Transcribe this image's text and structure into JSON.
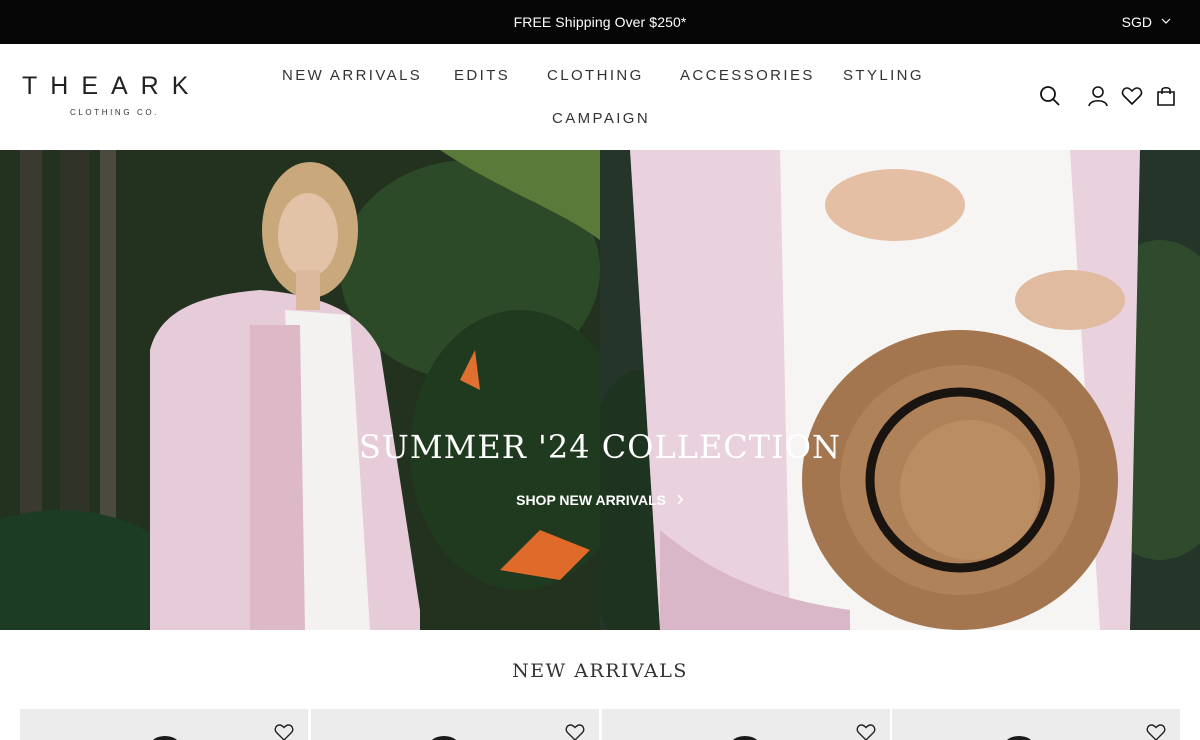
{
  "announcement": {
    "text": "FREE Shipping Over $250*",
    "currency": "SGD"
  },
  "header": {
    "logo_main": "THEARK",
    "logo_sub": "CLOTHING CO.",
    "nav": [
      "NEW ARRIVALS",
      "EDITS",
      "CLOTHING",
      "ACCESSORIES",
      "STYLING",
      "CAMPAIGN"
    ],
    "icons": [
      "search-icon",
      "account-icon",
      "wishlist-icon",
      "cart-icon"
    ]
  },
  "hero": {
    "title": "SUMMER '24 COLLECTION",
    "cta": "SHOP NEW ARRIVALS",
    "cta_icon": "chevron-right-icon"
  },
  "new_arrivals": {
    "title": "NEW ARRIVALS",
    "product_count": 4
  },
  "colors": {
    "announcement_bg": "#060606",
    "text": "#222222",
    "card_bg": "#ececec"
  }
}
